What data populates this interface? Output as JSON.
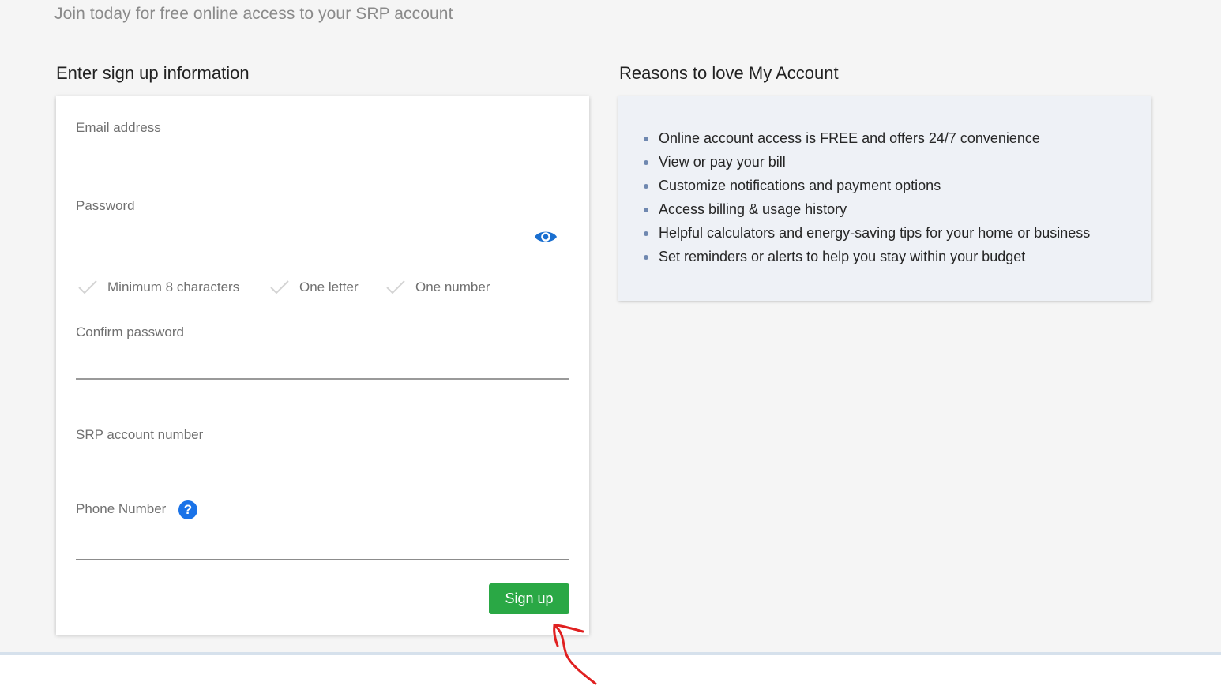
{
  "header": {
    "subtitle": "Join today for free online access to your SRP account"
  },
  "form": {
    "heading": "Enter sign up information",
    "email": {
      "label": "Email address",
      "value": ""
    },
    "password": {
      "label": "Password",
      "value": ""
    },
    "requirements": [
      "Minimum 8 characters",
      "One letter",
      "One number"
    ],
    "confirm_password": {
      "label": "Confirm password",
      "value": ""
    },
    "account_number": {
      "label": "SRP account number",
      "value": ""
    },
    "phone": {
      "label": "Phone Number",
      "value": "",
      "help_glyph": "?"
    },
    "submit_label": "Sign up"
  },
  "reasons": {
    "heading": "Reasons to love My Account",
    "items": [
      "Online account access is FREE and offers 24/7 convenience",
      "View or pay your bill",
      "Customize notifications and payment options",
      "Access billing & usage history",
      "Helpful calculators and energy-saving tips for your home or business",
      "Set reminders or alerts to help you stay within your budget"
    ]
  },
  "colors": {
    "accent_green": "#2aa845",
    "accent_blue": "#1a73e8",
    "annotation_red": "#e02020"
  },
  "icons": [
    "eye-icon",
    "check-icon",
    "help-icon",
    "annotation-arrow"
  ]
}
